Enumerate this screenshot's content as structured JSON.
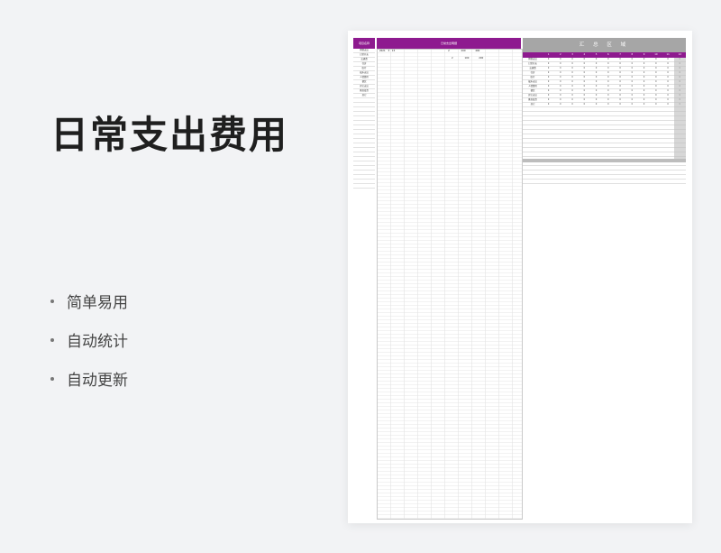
{
  "title": "日常支出费用",
  "features": [
    "简单易用",
    "自动统计",
    "自动更新"
  ],
  "sheet": {
    "category_header": "项目名称",
    "categories": [
      "购物支出",
      "日常开支",
      "交通费",
      "住房",
      "医疗",
      "娱乐支出",
      "人情费用",
      "餐饮",
      "其它支出",
      "教育投资",
      "其它"
    ],
    "main_header": "日常支出明细",
    "main_rows": [
      {
        "a": "2021",
        "b": "3",
        "c": "15",
        "d": "2",
        "e": "200",
        "f": "400"
      },
      {
        "a": "",
        "b": "",
        "c": "",
        "d": "2",
        "e": "100",
        "f": "200"
      }
    ],
    "summary_header": "汇 总 区 域",
    "months": [
      "1",
      "2",
      "3",
      "4",
      "5",
      "6",
      "7",
      "8",
      "9",
      "10",
      "11",
      "12"
    ],
    "summary_zero": "0"
  },
  "colors": {
    "accent": "#8e1a8f",
    "summary_header": "#a6a6a6"
  }
}
